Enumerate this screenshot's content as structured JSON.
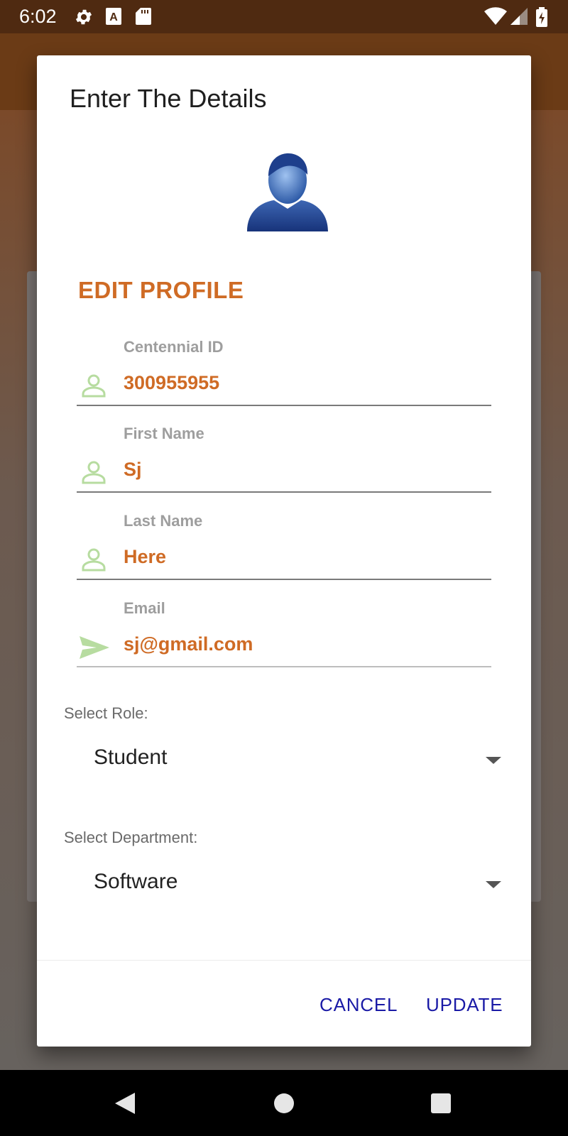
{
  "status_bar": {
    "time": "6:02",
    "icons": [
      "settings-gear-icon",
      "a-box-icon",
      "sd-card-icon",
      "wifi-icon",
      "cellular-signal-icon",
      "battery-charging-icon"
    ]
  },
  "dialog": {
    "title": "Enter The Details",
    "section_title": "EDIT PROFILE",
    "fields": [
      {
        "label": "Centennial ID",
        "value": "300955955",
        "icon": "person-icon"
      },
      {
        "label": "First Name",
        "value": "Sj",
        "icon": "person-icon"
      },
      {
        "label": "Last Name",
        "value": "Here",
        "icon": "person-icon"
      },
      {
        "label": "Email",
        "value": "sj@gmail.com",
        "icon": "send-icon"
      }
    ],
    "role": {
      "label": "Select Role:",
      "value": "Student"
    },
    "department": {
      "label": "Select Department:",
      "value": "Software"
    },
    "buttons": {
      "cancel": "CANCEL",
      "update": "UPDATE"
    }
  },
  "colors": {
    "accent": "#cf6b25",
    "icon_green": "#b7dca0",
    "button_text": "#1a1aa6",
    "status_bar": "#4f2a11",
    "app_bar": "#6b3b16"
  }
}
